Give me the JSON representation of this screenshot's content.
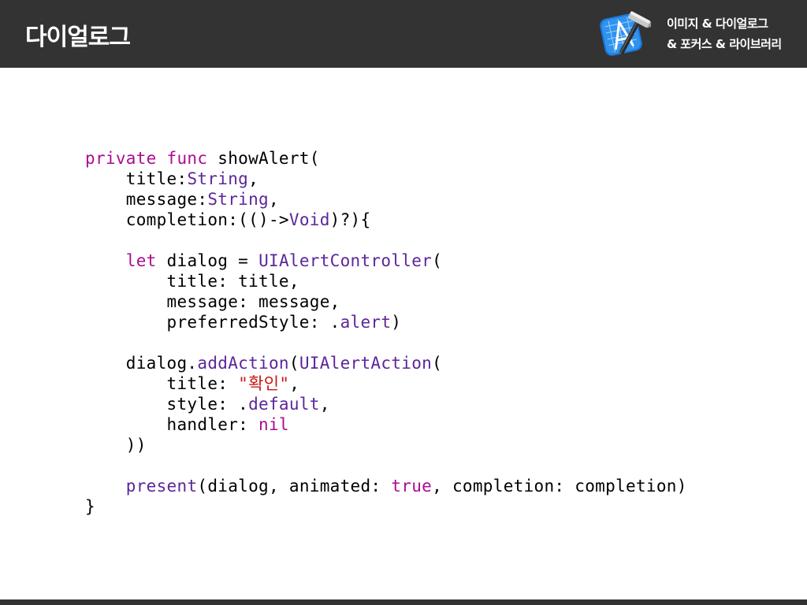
{
  "header": {
    "title": "다이얼로그",
    "subtitle_line1": "이미지 & 다이얼로그",
    "subtitle_line2": "& 포커스 & 라이브러리",
    "icon": "xcode-icon",
    "background_color": "#333333"
  },
  "code": {
    "colors": {
      "keyword": "#aa0d91",
      "type": "#5c2699",
      "string": "#c41a16",
      "plain": "#000000"
    },
    "lines": [
      [
        {
          "t": "private func ",
          "k": "kw"
        },
        {
          "t": "showAlert(",
          "k": "plain"
        }
      ],
      [
        {
          "t": "    title:",
          "k": "plain"
        },
        {
          "t": "String",
          "k": "ty"
        },
        {
          "t": ",",
          "k": "plain"
        }
      ],
      [
        {
          "t": "    message:",
          "k": "plain"
        },
        {
          "t": "String",
          "k": "ty"
        },
        {
          "t": ",",
          "k": "plain"
        }
      ],
      [
        {
          "t": "    completion:(()->",
          "k": "plain"
        },
        {
          "t": "Void",
          "k": "ty"
        },
        {
          "t": ")?){",
          "k": "plain"
        }
      ],
      [
        {
          "t": "",
          "k": "plain"
        }
      ],
      [
        {
          "t": "    ",
          "k": "plain"
        },
        {
          "t": "let",
          "k": "kw"
        },
        {
          "t": " dialog = ",
          "k": "plain"
        },
        {
          "t": "UIAlertController",
          "k": "ty"
        },
        {
          "t": "(",
          "k": "plain"
        }
      ],
      [
        {
          "t": "        title: title,",
          "k": "plain"
        }
      ],
      [
        {
          "t": "        message: message,",
          "k": "plain"
        }
      ],
      [
        {
          "t": "        preferredStyle: .",
          "k": "plain"
        },
        {
          "t": "alert",
          "k": "ty"
        },
        {
          "t": ")",
          "k": "plain"
        }
      ],
      [
        {
          "t": "",
          "k": "plain"
        }
      ],
      [
        {
          "t": "    dialog.",
          "k": "plain"
        },
        {
          "t": "addAction",
          "k": "ty"
        },
        {
          "t": "(",
          "k": "plain"
        },
        {
          "t": "UIAlertAction",
          "k": "ty"
        },
        {
          "t": "(",
          "k": "plain"
        }
      ],
      [
        {
          "t": "        title: ",
          "k": "plain"
        },
        {
          "t": "\"확인\"",
          "k": "str"
        },
        {
          "t": ",",
          "k": "plain"
        }
      ],
      [
        {
          "t": "        style: .",
          "k": "plain"
        },
        {
          "t": "default",
          "k": "ty"
        },
        {
          "t": ",",
          "k": "plain"
        }
      ],
      [
        {
          "t": "        handler: ",
          "k": "plain"
        },
        {
          "t": "nil",
          "k": "kw"
        }
      ],
      [
        {
          "t": "    ))",
          "k": "plain"
        }
      ],
      [
        {
          "t": "",
          "k": "plain"
        }
      ],
      [
        {
          "t": "    ",
          "k": "plain"
        },
        {
          "t": "present",
          "k": "ty"
        },
        {
          "t": "(dialog, animated: ",
          "k": "plain"
        },
        {
          "t": "true",
          "k": "kw"
        },
        {
          "t": ", completion: completion)",
          "k": "plain"
        }
      ],
      [
        {
          "t": "}",
          "k": "plain"
        }
      ]
    ]
  }
}
